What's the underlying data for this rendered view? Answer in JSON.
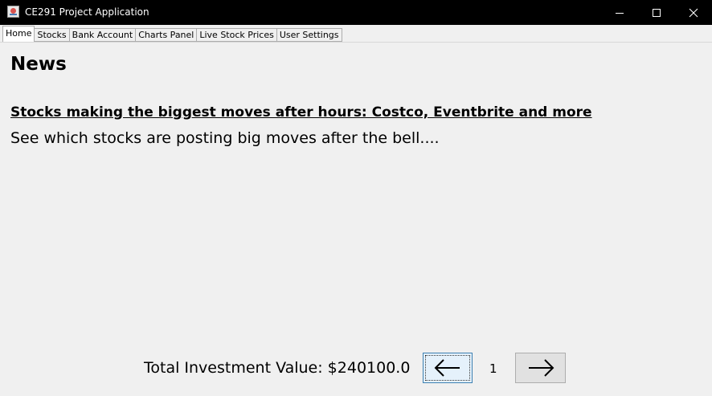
{
  "window": {
    "title": "CE291 Project Application",
    "icon": "java-app-icon"
  },
  "tabs": [
    {
      "label": "Home",
      "active": true
    },
    {
      "label": "Stocks",
      "active": false
    },
    {
      "label": "Bank Account",
      "active": false
    },
    {
      "label": "Charts Panel",
      "active": false
    },
    {
      "label": "Live Stock Prices",
      "active": false
    },
    {
      "label": "User Settings",
      "active": false
    }
  ],
  "news": {
    "title": "News",
    "headline": "Stocks making the biggest moves after hours: Costco, Eventbrite and more",
    "summary": "See which stocks are posting big moves after the bell...."
  },
  "footer": {
    "investment_text": "Total Investment Value: $240100.0",
    "page": "1",
    "prev_icon": "arrow-left-icon",
    "next_icon": "arrow-right-icon"
  }
}
